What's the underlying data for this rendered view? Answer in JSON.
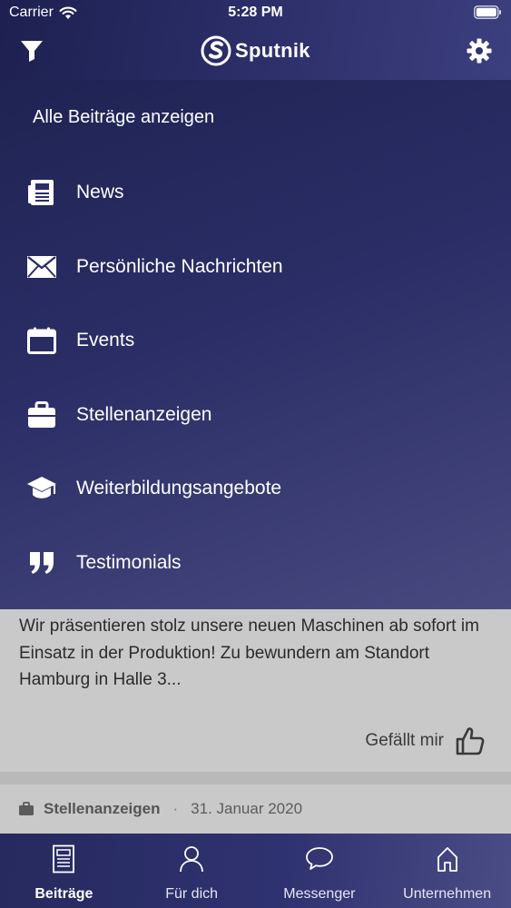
{
  "status_bar": {
    "carrier": "Carrier",
    "time": "5:28 PM"
  },
  "header": {
    "app_title": "Sputnik"
  },
  "filter_menu": {
    "all_label": "Alle Beiträge anzeigen",
    "items": [
      {
        "label": "News",
        "icon": "newspaper-icon"
      },
      {
        "label": "Persönliche Nachrichten",
        "icon": "envelope-icon"
      },
      {
        "label": "Events",
        "icon": "calendar-icon"
      },
      {
        "label": "Stellenanzeigen",
        "icon": "briefcase-icon"
      },
      {
        "label": "Weiterbildungsangebote",
        "icon": "graduation-cap-icon"
      },
      {
        "label": "Testimonials",
        "icon": "quote-icon"
      }
    ]
  },
  "feed": {
    "post_text": "Wir präsentieren stolz unsere neuen Maschinen ab sofort im Einsatz in der Produktion! Zu bewundern am Standort Hamburg in Halle 3...",
    "like_label": "Gefällt mir",
    "next_post": {
      "category": "Stellenanzeigen",
      "date": "31. Januar 2020"
    }
  },
  "tabs": [
    {
      "label": "Beiträge",
      "icon": "document-icon",
      "active": true
    },
    {
      "label": "Für dich",
      "icon": "person-icon",
      "active": false
    },
    {
      "label": "Messenger",
      "icon": "chat-bubble-icon",
      "active": false
    },
    {
      "label": "Unternehmen",
      "icon": "home-icon",
      "active": false
    }
  ],
  "colors": {
    "primary": "#2a2d66",
    "accent_light": "#47497f",
    "feed_background": "#c9c9c9"
  }
}
